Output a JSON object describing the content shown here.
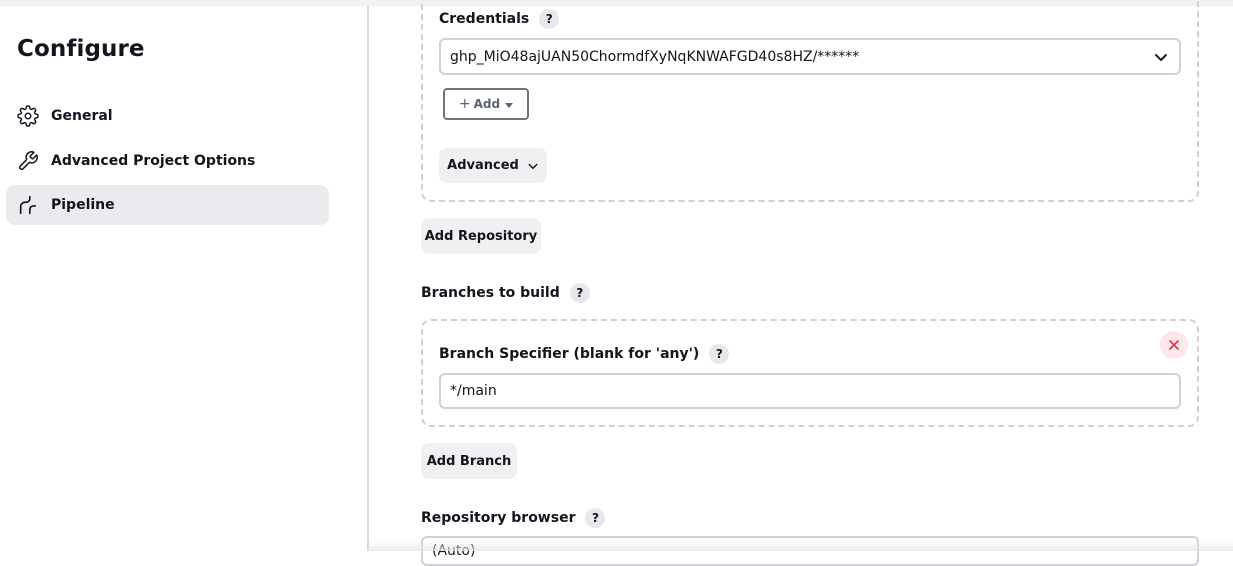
{
  "sidebar": {
    "title": "Configure",
    "items": [
      {
        "label": "General",
        "icon": "gear-icon"
      },
      {
        "label": "Advanced Project Options",
        "icon": "wrench-icon"
      },
      {
        "label": "Pipeline",
        "icon": "pipeline-icon",
        "active": true
      }
    ]
  },
  "credentials": {
    "label": "Credentials",
    "help": "?",
    "selected": "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/******",
    "add_label": "Add",
    "advanced_label": "Advanced"
  },
  "add_repository_label": "Add Repository",
  "branches": {
    "label": "Branches to build",
    "help": "?",
    "specifier_label": "Branch Specifier (blank for 'any')",
    "specifier_help": "?",
    "specifier_value": "*/main",
    "add_branch_label": "Add Branch"
  },
  "repository_browser": {
    "label": "Repository browser",
    "help": "?",
    "value": "(Auto)"
  },
  "colors": {
    "accent_active_bg": "#ebebef",
    "danger": "#e0334d"
  }
}
